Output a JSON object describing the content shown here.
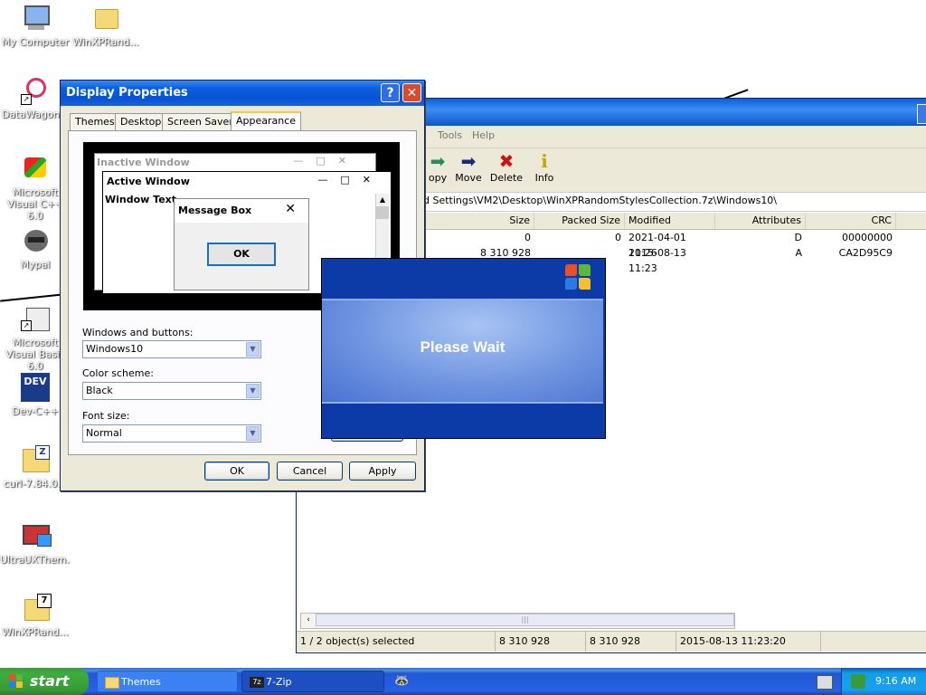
{
  "desktop": {
    "icons": [
      {
        "label": "My Computer"
      },
      {
        "label": "WinXPRand..."
      },
      {
        "label": "DataWagon..."
      },
      {
        "label": "Microsoft Visual C++ 6.0"
      },
      {
        "label": "Mypal"
      },
      {
        "label": "Microsoft Visual Basic 6.0"
      },
      {
        "label": "Dev-C++"
      },
      {
        "label": "curl-7.84.0..."
      },
      {
        "label": "UltraUXThem..."
      },
      {
        "label": "WinXPRand..."
      }
    ]
  },
  "sevenzip": {
    "menu": {
      "tools": "Tools",
      "help": "Help"
    },
    "toolbar": {
      "copy": "opy",
      "move": "Move",
      "delete": "Delete",
      "info": "Info"
    },
    "address": "d Settings\\VM2\\Desktop\\WinXPRandomStylesCollection.7z\\Windows10\\",
    "columns": {
      "size": "Size",
      "packed": "Packed Size",
      "modified": "Modified",
      "attributes": "Attributes",
      "crc": "CRC"
    },
    "rows": [
      {
        "size": "0",
        "packed": "0",
        "modified": "2021-04-01 11:26",
        "attributes": "D",
        "crc": "00000000"
      },
      {
        "size": "8 310 928",
        "packed": "",
        "modified": "2015-08-13 11:23",
        "attributes": "A",
        "crc": "CA2D95C9"
      }
    ],
    "status": {
      "selected": "1 / 2 object(s) selected",
      "size": "8 310 928",
      "packed": "8 310 928",
      "modified": "2015-08-13 11:23:20"
    }
  },
  "display_properties": {
    "title": "Display Properties",
    "tabs": [
      "Themes",
      "Desktop",
      "Screen Saver",
      "Appearance"
    ],
    "preview": {
      "inactive": "Inactive Window",
      "active": "Active Window",
      "window_text": "Window Text",
      "message_box": "Message Box",
      "ok": "OK"
    },
    "windows_buttons_label": "Windows and buttons:",
    "windows_buttons_value": "Windows10",
    "color_scheme_label": "Color scheme:",
    "color_scheme_value": "Black",
    "font_size_label": "Font size:",
    "font_size_value": "Normal",
    "buttons": {
      "ok": "OK",
      "cancel": "Cancel",
      "apply": "Apply"
    }
  },
  "please_wait": {
    "text": "Please Wait"
  },
  "taskbar": {
    "start": "start",
    "tasks": [
      {
        "label": "Themes"
      },
      {
        "label": "7-Zip"
      }
    ],
    "clock": "9:16 AM"
  },
  "colors": {
    "xp_blue": "#0a56d0",
    "start_green": "#3dad3d",
    "wait_blue": "#0c3aa6"
  }
}
